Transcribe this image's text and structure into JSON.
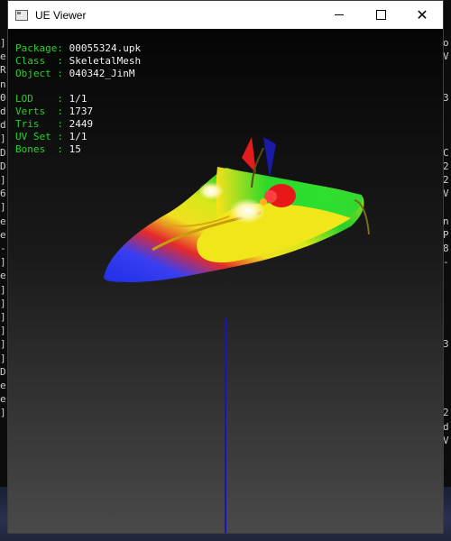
{
  "window": {
    "title": "UE Viewer",
    "controls": [
      "minimize",
      "maximize",
      "close"
    ],
    "close_glyph": "✕"
  },
  "info": {
    "package_label": "Package:",
    "package": "00055324.upk",
    "class_label": "Class  :",
    "class": "SkeletalMesh",
    "object_label": "Object :",
    "object": "040342_JinM",
    "lod_label": "LOD    :",
    "lod": "1/1",
    "verts_label": "Verts  :",
    "verts": "1737",
    "tris_label": "Tris   :",
    "tris": "2449",
    "uvset_label": "UV Set :",
    "uvset": "1/1",
    "bones_label": "Bones  :",
    "bones": "15"
  },
  "background_console": {
    "left_chars": "]\ne\nR\nn\n0\nd\nd\n]\nD\nD\n]\n6\n]\ne\ne\n-\n]\ne\n]\n]\n]\n]\n]\n]\nD\ne\ne\n]",
    "right_chars": "o\nV\n\n\n3\n\n\n\nC\n2\n2\nV\n\nn\nP\n8\n-\n\n\n\n\n\n3\n\n\n\n\n2\nd\nV"
  },
  "colors": {
    "label_green": "#27d127",
    "value_white": "#f2f2f2",
    "axis_blue": "#1414c8"
  }
}
